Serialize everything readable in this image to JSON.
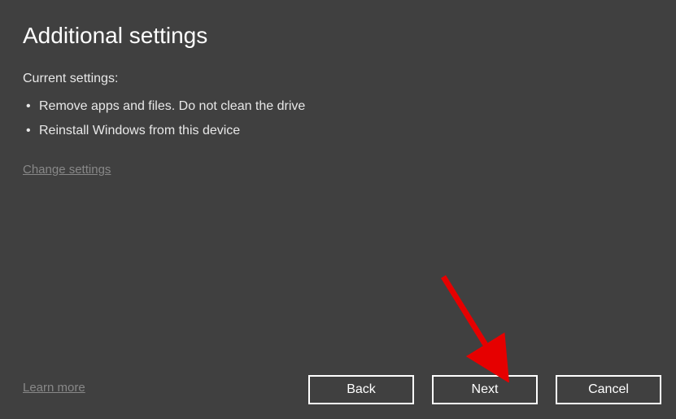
{
  "title": "Additional settings",
  "currentSettingsLabel": "Current settings:",
  "settings": [
    "Remove apps and files. Do not clean the drive",
    "Reinstall Windows from this device"
  ],
  "changeSettingsLabel": "Change settings",
  "learnMoreLabel": "Learn more",
  "buttons": {
    "back": "Back",
    "next": "Next",
    "cancel": "Cancel"
  },
  "annotation": {
    "arrowColor": "#e60000",
    "target": "next-button"
  }
}
